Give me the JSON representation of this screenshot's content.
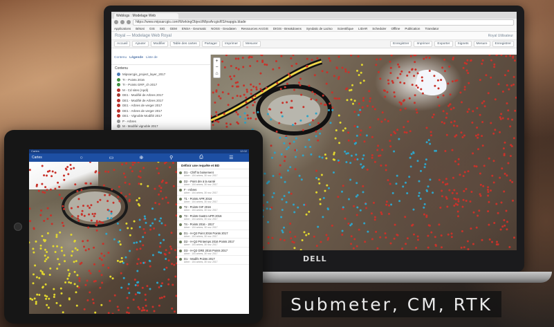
{
  "browser": {
    "tab_title": "Weblogs : Modelage Web",
    "address": "https://www.mipsarcgis.com/WorkingObject/MipsArcgisRS/mapgis.blade",
    "bookmarks": [
      "Applications",
      "Bétoni",
      "GIS",
      "SIG",
      "GEM",
      "ENSA - Geomatic",
      "NOSS - Geodaten",
      "Ressources ArcGIS",
      "DIGIS - Breakdowns",
      "Syndatic de Laziso",
      "Scientifique",
      "LIDAR",
      "Scheduler",
      "Offline",
      "Publication",
      "Translator"
    ]
  },
  "app": {
    "title": "Royal — Modelage Web Royal",
    "user": "Royal Utilisateur",
    "toolbar": [
      "Accueil",
      "Ajouter",
      "Modifier",
      "Table des cartes",
      "Partager",
      "Imprimer",
      "Mesurer",
      "Enregistrer",
      "Imprimer",
      "Exporter",
      "Signets",
      "Mesure",
      "Enregistrer"
    ]
  },
  "layers_panel": {
    "tabs": [
      "Contenu",
      "Légende",
      "Liste de"
    ],
    "heading": "Contenu",
    "items": [
      {
        "label": "Mipsarcgis_project_layer_2017",
        "color": "#4a7ab5"
      },
      {
        "label": "Tr - Points 2016",
        "color": "#3f8f3f"
      },
      {
        "label": "Tr - Points GRP_ch 2017",
        "color": "#3f8f3f"
      },
      {
        "label": "M - Cd sites (Apdi)",
        "color": "#b8302a"
      },
      {
        "label": "DE1 - Modifié de Arbres 2017",
        "color": "#a0352c"
      },
      {
        "label": "DE1 - Modifié de Arbres 2017",
        "color": "#b8302a"
      },
      {
        "label": "DE1 - Arbres de verger 2017",
        "color": "#b8302a"
      },
      {
        "label": "DE1 - Arbres de verger 2017",
        "color": "#b8302a"
      },
      {
        "label": "DE1 - Vignoble Modifié 2017",
        "color": "#b8302a"
      },
      {
        "label": "P - Arbres",
        "color": "#9a9a9a"
      },
      {
        "label": "M - Modifié vignoble 2017",
        "color": "#9a9a9a"
      }
    ]
  },
  "laptop": {
    "brand": "DELL"
  },
  "tablet": {
    "status_left": "Cartes",
    "status_right": "12:02",
    "nav_title": "Cartes",
    "nav_icons": [
      "○",
      "▭",
      "⊕",
      "⚲",
      "⎙",
      "☰"
    ],
    "list_title": "Définir une requête et BD",
    "rows": [
      {
        "name": "D1 - Chiff to boisement",
        "sub": "Arbre : 104 arbres, 30 nov. 2017"
      },
      {
        "name": "D2 - Point dre à la santé",
        "sub": "Arbre : 104 arbres, 30 nov. 2017"
      },
      {
        "name": "F - Arbres",
        "sub": "Arbre : 104 arbres, 30 nov. 2017"
      },
      {
        "name": "T1 - Points APR 2016",
        "sub": "Arbre : 104 arbres, 30 nov. 2017"
      },
      {
        "name": "T2 - Points GIF 2016",
        "sub": "Arbre : 104 arbres, 30 nov. 2017"
      },
      {
        "name": "T3 - Points Gastro UPR 2016",
        "sub": "Arbre : 104 arbres, 30 nov. 2017"
      },
      {
        "name": "T4 - Points 2016 - 2017",
        "sub": "Arbre : 104 arbres, 30 nov. 2017"
      },
      {
        "name": "D1 - H-Q2 Point 2016 Points 2017",
        "sub": "Arbre : 104 arbres, 30 nov. 2017"
      },
      {
        "name": "D2 - H-Q2 Printemps 2016 Points 2017",
        "sub": "Arbre : 104 arbres, 30 nov. 2017"
      },
      {
        "name": "D3 - H-Q2 GRE 2016 Points 2017",
        "sub": "Arbre : 104 arbres, 30 nov. 2017"
      },
      {
        "name": "D1 - Modifs Points 2017",
        "sub": "Arbre : 104 arbres, 30 nov. 2017"
      }
    ]
  },
  "tagline": "Submeter, CM, RTK",
  "colors": {
    "tablet_nav": "#1d4fa3",
    "point_red": "#c8322a",
    "point_cyan": "#2fa4c7",
    "point_yellow": "#e2d72e"
  }
}
